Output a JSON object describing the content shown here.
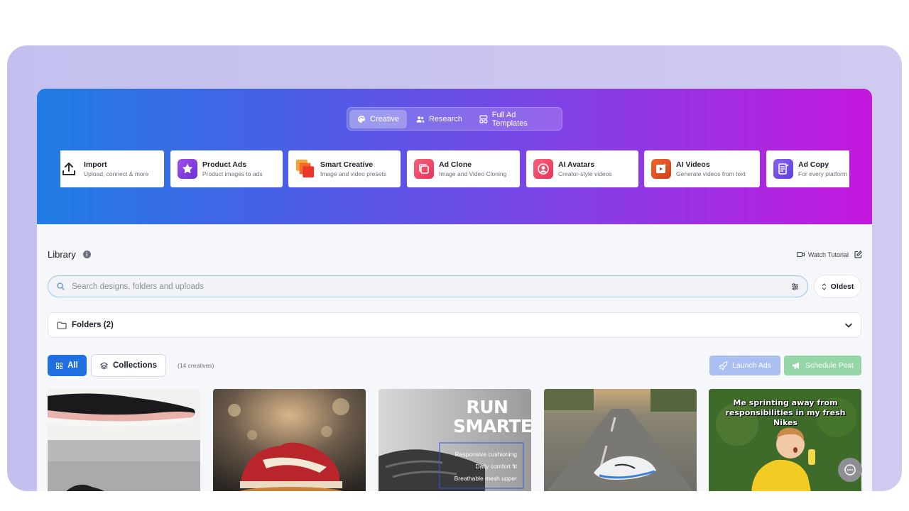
{
  "header": {
    "tabs": [
      {
        "label": "Creative",
        "icon": "palette-icon",
        "active": true
      },
      {
        "label": "Research",
        "icon": "users-icon",
        "active": false
      },
      {
        "label": "Full Ad Templates",
        "icon": "template-icon",
        "active": false
      }
    ],
    "tools": [
      {
        "title": "Import",
        "subtitle": "Upload, connect & more",
        "icon": "upload-icon"
      },
      {
        "title": "Product Ads",
        "subtitle": "Product images to ads",
        "icon": "star-icon",
        "color": "#8b3fe0"
      },
      {
        "title": "Smart Creative",
        "subtitle": "Image and video presets",
        "icon": "layers-icon",
        "color": "#f05a28"
      },
      {
        "title": "Ad Clone",
        "subtitle": "Image and Video Cloning",
        "icon": "clone-icon",
        "color": "#f0456b"
      },
      {
        "title": "AI Avatars",
        "subtitle": "Creator-style videos",
        "icon": "avatar-icon",
        "color": "#f0456b"
      },
      {
        "title": "AI Videos",
        "subtitle": "Generate videos from text",
        "icon": "video-icon",
        "color": "#e0451e"
      },
      {
        "title": "Ad Copy",
        "subtitle": "For every platform",
        "icon": "document-icon",
        "color": "#6b4de6"
      }
    ]
  },
  "library": {
    "title": "Library",
    "watch_tutorial": "Watch Tutorial",
    "search_placeholder": "Search designs, folders and uploads",
    "sort_label": "Oldest",
    "folders_label": "Folders (2)",
    "filter_all": "All",
    "filter_collections": "Collections",
    "creatives_count": "(14 creatives)",
    "launch_ads": "Launch Ads",
    "schedule_post": "Schedule Post"
  },
  "cards": [
    {
      "name": "creative-shoe-white-pink"
    },
    {
      "name": "creative-red-sneaker"
    },
    {
      "name": "creative-run-smarter",
      "headline": "RUN SMARTER",
      "bullets": [
        "Responsive cushioning",
        "Daily comfort fit",
        "Breathable mesh upper"
      ]
    },
    {
      "name": "creative-shoe-on-road"
    },
    {
      "name": "creative-meme",
      "caption": "Me sprinting away from responsibilities in my fresh Nikes"
    }
  ],
  "colors": {
    "primary": "#1f6fe0",
    "launch": "#a9bff2",
    "schedule": "#94d6a8",
    "gradient_start": "#1f7de3",
    "gradient_end": "#c417de"
  }
}
